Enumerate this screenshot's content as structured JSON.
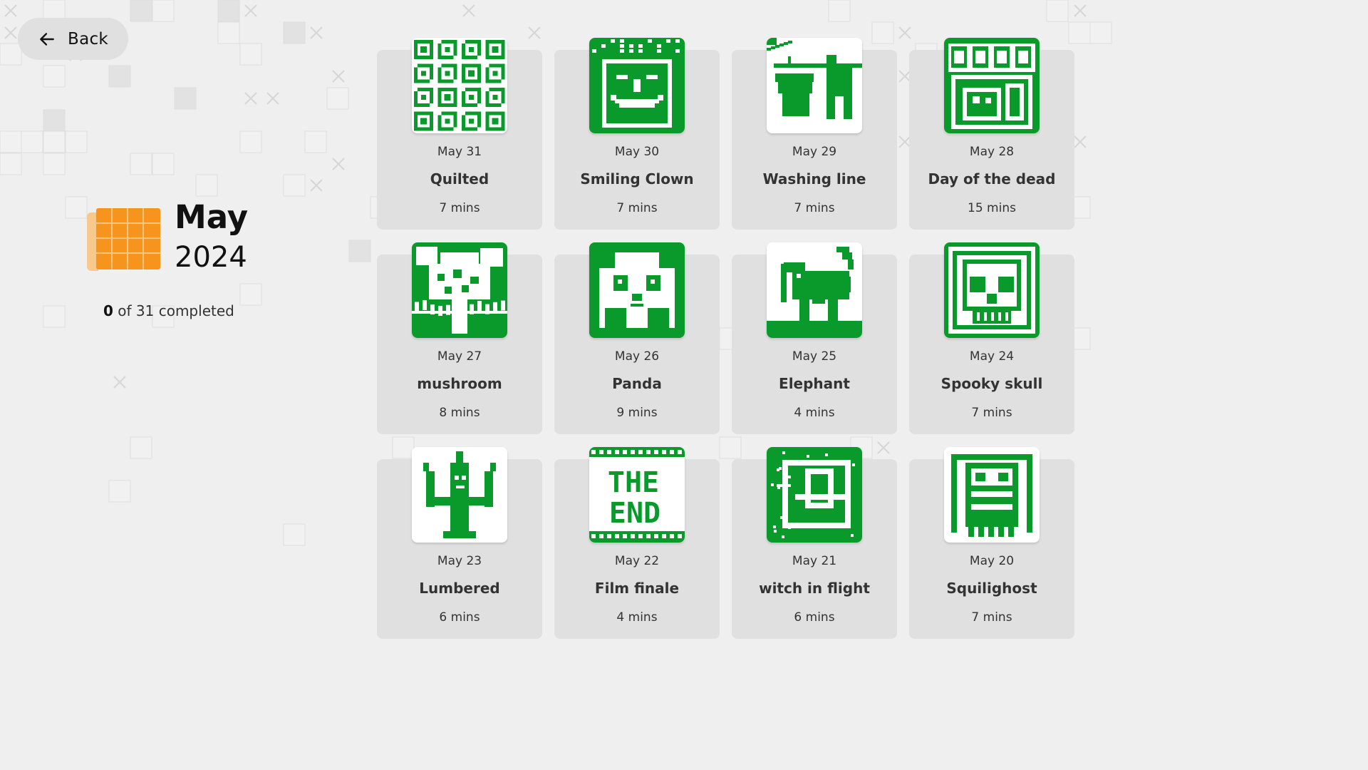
{
  "nav": {
    "back_label": "Back",
    "back_icon": "arrow-left-icon"
  },
  "header": {
    "month": "May",
    "year": "2024",
    "calendar_icon": "calendar-icon",
    "completed_count": "0",
    "completed_text": " of 31 completed"
  },
  "colors": {
    "accent": "#f7941d",
    "pixel_green": "#0a9a2c",
    "card_bg": "#e0e0e0",
    "page_bg": "#efefef"
  },
  "puzzles": [
    {
      "date": "May 31",
      "name": "Quilted",
      "duration": "7 mins",
      "art": "quilted"
    },
    {
      "date": "May 30",
      "name": "Smiling Clown",
      "duration": "7 mins",
      "art": "clown"
    },
    {
      "date": "May 29",
      "name": "Washing line",
      "duration": "7 mins",
      "art": "washing-line"
    },
    {
      "date": "May 28",
      "name": "Day of the dead",
      "duration": "15 mins",
      "art": "day-of-dead"
    },
    {
      "date": "May 27",
      "name": "mushroom",
      "duration": "8 mins",
      "art": "mushroom"
    },
    {
      "date": "May 26",
      "name": "Panda",
      "duration": "9 mins",
      "art": "panda"
    },
    {
      "date": "May 25",
      "name": "Elephant",
      "duration": "4 mins",
      "art": "elephant"
    },
    {
      "date": "May 24",
      "name": "Spooky skull",
      "duration": "7 mins",
      "art": "skull"
    },
    {
      "date": "May 23",
      "name": "Lumbered",
      "duration": "6 mins",
      "art": "lumbered"
    },
    {
      "date": "May 22",
      "name": "Film finale",
      "duration": "4 mins",
      "art": "film-finale"
    },
    {
      "date": "May 21",
      "name": "witch in flight",
      "duration": "6 mins",
      "art": "witch"
    },
    {
      "date": "May 20",
      "name": "Squilighost",
      "duration": "7 mins",
      "art": "squilighost"
    }
  ]
}
